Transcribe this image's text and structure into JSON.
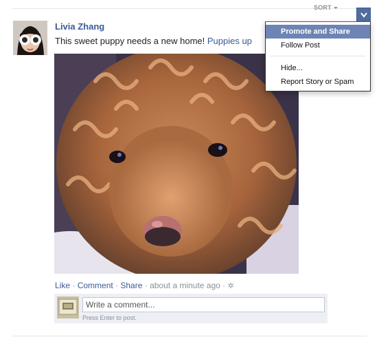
{
  "feed": {
    "sort_label": "SORT"
  },
  "story": {
    "author": "Livia Zhang",
    "text": "This sweet puppy needs a new home! ",
    "link_text": "Puppies up",
    "actions": {
      "like": "Like",
      "sep": " · ",
      "comment": "Comment",
      "share": "Share",
      "timestamp": "about a minute ago"
    },
    "comment_placeholder": "Write a comment...",
    "comment_hint": "Press Enter to post."
  },
  "dropdown": {
    "items": [
      {
        "label": "Promote and Share",
        "active": true
      },
      {
        "label": "Follow Post",
        "active": false
      },
      {
        "label": "Hide...",
        "active": false
      },
      {
        "label": "Report Story or Spam",
        "active": false
      }
    ]
  },
  "colors": {
    "link_blue": "#3b5998",
    "menu_highlight": "#6d84b4"
  }
}
